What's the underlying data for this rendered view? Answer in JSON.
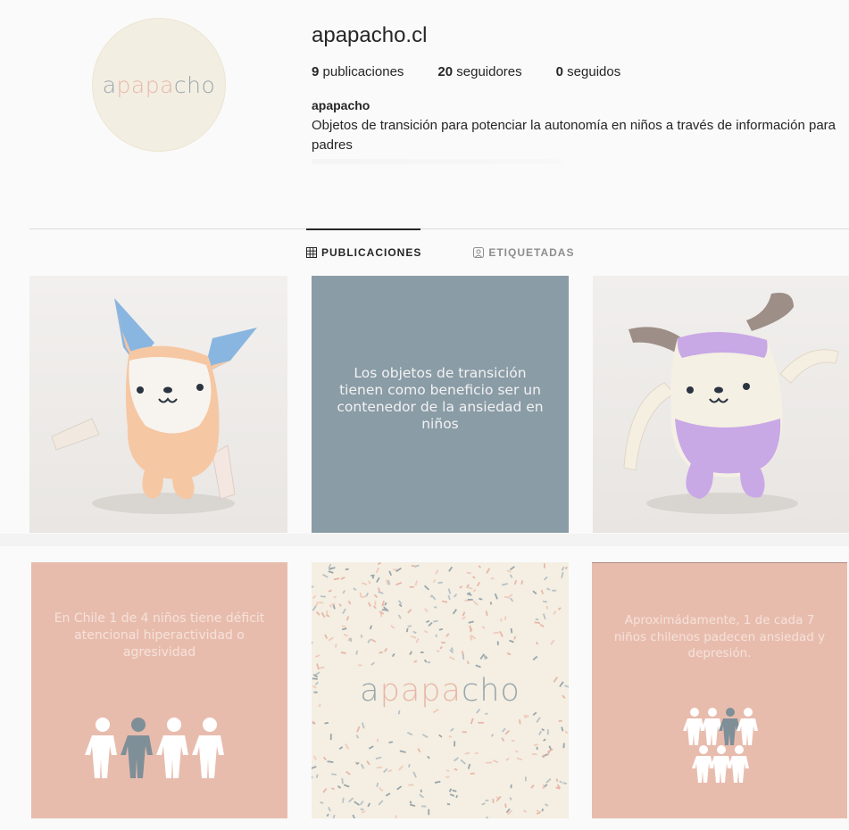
{
  "profile": {
    "avatar_logo": [
      "a",
      "papa",
      "cho"
    ],
    "username": "apapacho.cl",
    "stats": [
      {
        "count": "9",
        "label": " publicaciones"
      },
      {
        "count": "20",
        "label": " seguidores"
      },
      {
        "count": "0",
        "label": " seguidos"
      }
    ],
    "bio_name": "apapacho",
    "bio_text": "Objetos de transición para potenciar la autonomía en niños a través de información para padres"
  },
  "tabs": [
    {
      "label": "PUBLICACIONES",
      "icon": "grid-icon",
      "active": true
    },
    {
      "label": "ETIQUETADAS",
      "icon": "tag-icon",
      "active": false
    }
  ],
  "posts": {
    "p2_text": "Los objetos de transición tienen como beneficio ser un contenedor de la ansiedad en niños",
    "p4_text": "En Chile 1 de 4 niños tiene déficit atencional hiperactividad o agresividad",
    "p5_logo": [
      "a",
      "papa",
      "cho"
    ],
    "p6_text": "Aproximádamente, 1 de cada 7 niños chilenos padecen ansiedad y depresión."
  },
  "colors": {
    "slate": "#8a9ca6",
    "peach": "#e8bcad",
    "cream": "#f4efe2",
    "figure_white": "#ffffff",
    "figure_gray": "#7f8f98"
  }
}
